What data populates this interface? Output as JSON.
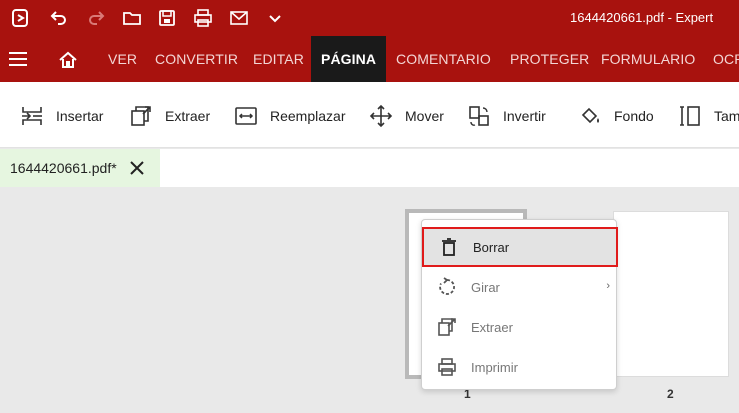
{
  "titlebar": {
    "title": "1644420661.pdf  -  Expert",
    "icons": [
      "app-logo-icon",
      "undo-icon",
      "redo-icon",
      "open-folder-icon",
      "save-icon",
      "print-icon",
      "mail-icon",
      "chevron-down-icon"
    ]
  },
  "menubar": {
    "items": [
      "VER",
      "CONVERTIR",
      "EDITAR",
      "PÁGINA",
      "COMENTARIO",
      "PROTEGER",
      "FORMULARIO",
      "OCR"
    ],
    "active": "PÁGINA"
  },
  "ribbon": {
    "insertar": "Insertar",
    "extraer": "Extraer",
    "reemplazar": "Reemplazar",
    "mover": "Mover",
    "invertir": "Invertir",
    "fondo": "Fondo",
    "tam": "Tam"
  },
  "doctab": {
    "label": "1644420661.pdf*"
  },
  "pages": {
    "p1": "1",
    "p2": "2"
  },
  "context_menu": {
    "borrar": "Borrar",
    "girar": "Girar",
    "extraer": "Extraer",
    "imprimir": "Imprimir"
  }
}
